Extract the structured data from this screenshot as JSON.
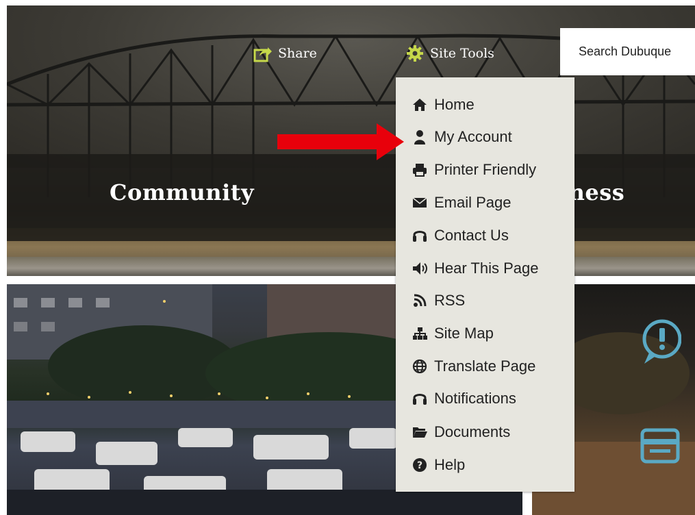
{
  "header": {
    "share_label": "Share",
    "site_tools_label": "Site Tools",
    "search_placeholder": "Search Dubuque"
  },
  "banner": {
    "left_title": "Community",
    "right_title_partial": "iness"
  },
  "site_tools_menu": {
    "items": [
      {
        "label": "Home",
        "icon": "home-icon"
      },
      {
        "label": "My Account",
        "icon": "user-icon"
      },
      {
        "label": "Printer Friendly",
        "icon": "printer-icon"
      },
      {
        "label": "Email Page",
        "icon": "envelope-icon"
      },
      {
        "label": "Contact Us",
        "icon": "headset-icon"
      },
      {
        "label": "Hear This Page",
        "icon": "speaker-icon"
      },
      {
        "label": "RSS",
        "icon": "rss-icon"
      },
      {
        "label": "Site Map",
        "icon": "sitemap-icon"
      },
      {
        "label": "Translate Page",
        "icon": "globe-icon"
      },
      {
        "label": "Notifications",
        "icon": "headset-icon"
      },
      {
        "label": "Documents",
        "icon": "folder-icon"
      },
      {
        "label": "Help",
        "icon": "question-icon"
      }
    ]
  },
  "colors": {
    "icon_green": "#c6d84a",
    "menu_bg": "#e7e6df",
    "accent_blue": "#5aa9c4",
    "annotation_red": "#e8000b"
  }
}
